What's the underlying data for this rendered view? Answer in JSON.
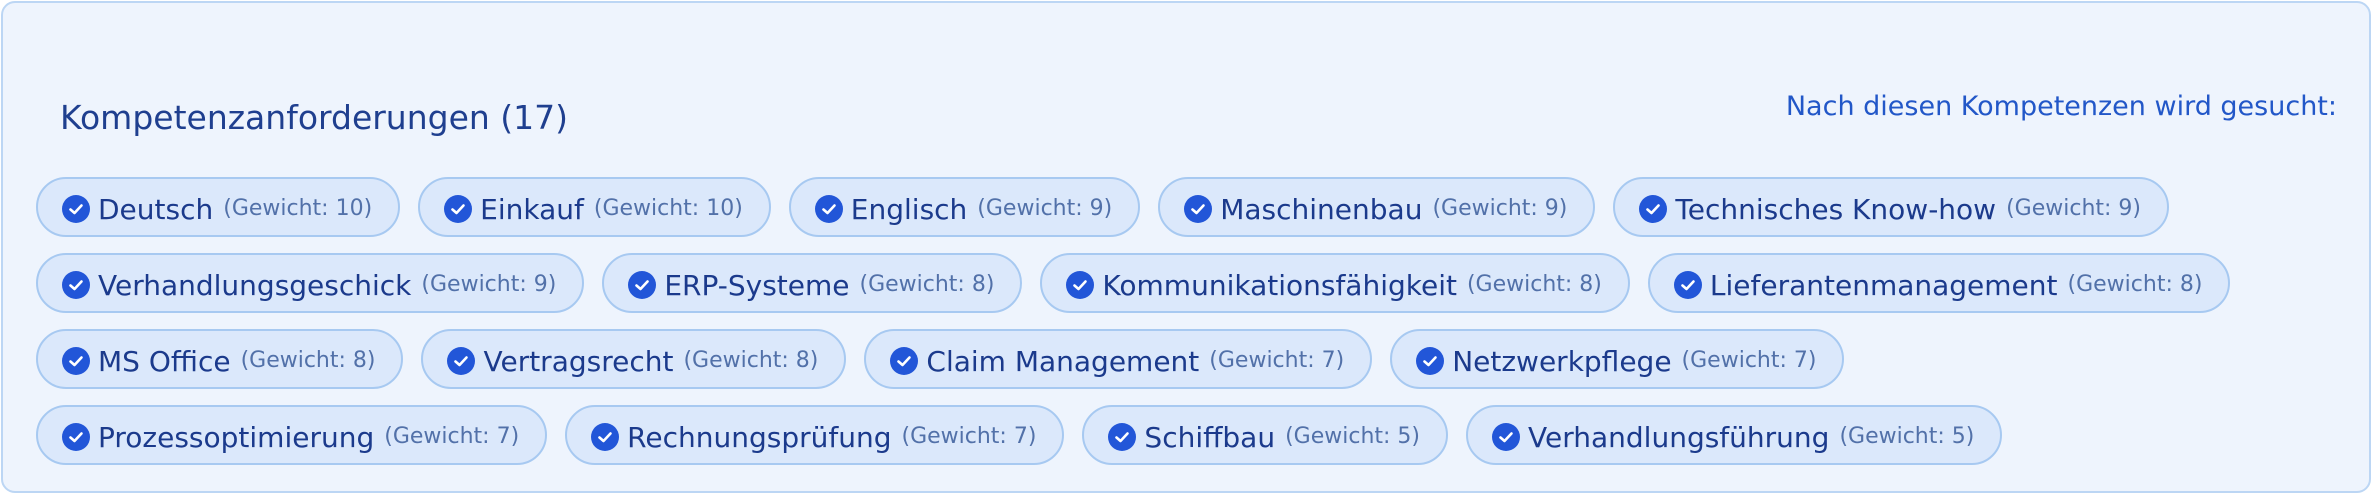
{
  "panel": {
    "title": "Kompetenzanforderungen (17)",
    "hint": "Nach diesen Kompetenzen wird gesucht:"
  },
  "competencies": [
    {
      "label": "Deutsch",
      "weight": "(Gewicht: 10)"
    },
    {
      "label": "Einkauf",
      "weight": "(Gewicht: 10)"
    },
    {
      "label": "Englisch",
      "weight": "(Gewicht: 9)"
    },
    {
      "label": "Maschinenbau",
      "weight": "(Gewicht: 9)"
    },
    {
      "label": "Technisches Know-how",
      "weight": "(Gewicht: 9)"
    },
    {
      "label": "Verhandlungsgeschick",
      "weight": "(Gewicht: 9)"
    },
    {
      "label": "ERP-Systeme",
      "weight": "(Gewicht: 8)"
    },
    {
      "label": "Kommunikationsfähigkeit",
      "weight": "(Gewicht: 8)"
    },
    {
      "label": "Lieferantenmanagement",
      "weight": "(Gewicht: 8)"
    },
    {
      "label": "MS Office",
      "weight": "(Gewicht: 8)"
    },
    {
      "label": "Vertragsrecht",
      "weight": "(Gewicht: 8)"
    },
    {
      "label": "Claim Management",
      "weight": "(Gewicht: 7)"
    },
    {
      "label": "Netzwerkpflege",
      "weight": "(Gewicht: 7)"
    },
    {
      "label": "Prozessoptimierung",
      "weight": "(Gewicht: 7)"
    },
    {
      "label": "Rechnungsprüfung",
      "weight": "(Gewicht: 7)"
    },
    {
      "label": "Schiffbau",
      "weight": "(Gewicht: 5)"
    },
    {
      "label": "Verhandlungsführung",
      "weight": "(Gewicht: 5)"
    }
  ],
  "icons": {
    "chip_icon": "check-circle-icon"
  },
  "colors": {
    "accent": "#2256d8",
    "chip_background": "#dbe8fb",
    "chip_border": "#a7c9f1",
    "panel_background": "#eef4fd",
    "title": "#1f3f8f"
  }
}
